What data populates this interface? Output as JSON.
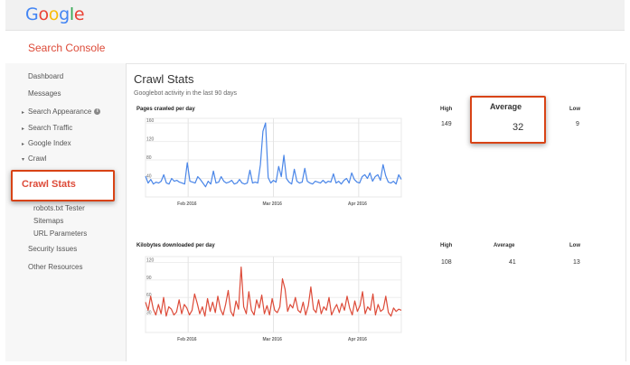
{
  "header": {
    "logo": [
      "G",
      "o",
      "o",
      "g",
      "l",
      "e"
    ],
    "logo_colors": [
      "#4285f4",
      "#ea4335",
      "#fbbc05",
      "#4285f4",
      "#34a853",
      "#ea4335"
    ],
    "product": "Search Console"
  },
  "sidebar": {
    "dashboard": "Dashboard",
    "messages": "Messages",
    "search_appearance": "Search Appearance",
    "search_traffic": "Search Traffic",
    "google_index": "Google Index",
    "crawl": "Crawl",
    "robots_tester": "robots.txt Tester",
    "sitemaps": "Sitemaps",
    "url_parameters": "URL Parameters",
    "security_issues": "Security Issues",
    "other_resources": "Other Resources",
    "info_glyph": "i",
    "caret_right": "▸",
    "caret_down": "▾"
  },
  "callouts": {
    "crawl_stats": "Crawl Stats",
    "average_label": "Average",
    "average_value": "32"
  },
  "main": {
    "title": "Crawl Stats",
    "subtitle": "Googlebot activity in the last 90 days"
  },
  "colors": {
    "accent": "#dd4b39",
    "highlight_border": "#d84315",
    "pages_line": "#4a86e8",
    "kb_line": "#dd4b39"
  },
  "stats": [
    {
      "high_label": "High",
      "high": "149",
      "avg_label": "Average",
      "avg": "32",
      "low_label": "Low",
      "low": "9"
    },
    {
      "high_label": "High",
      "high": "108",
      "avg_label": "Average",
      "avg": "41",
      "low_label": "Low",
      "low": "13"
    }
  ],
  "chart_data": [
    {
      "type": "line",
      "title": "Pages crawled per day",
      "x_ticks": [
        "Feb 2016",
        "Mar 2016",
        "Apr 2016"
      ],
      "y_ticks": [
        40,
        80,
        120,
        160
      ],
      "ylim": [
        0,
        170
      ],
      "grid": true,
      "series": [
        {
          "values": [
            45,
            30,
            38,
            28,
            32,
            30,
            34,
            48,
            30,
            28,
            40,
            34,
            36,
            32,
            30,
            28,
            74,
            34,
            32,
            30,
            44,
            38,
            30,
            22,
            34,
            28,
            56,
            30,
            32,
            44,
            34,
            30,
            32,
            36,
            28,
            30,
            38,
            30,
            28,
            30,
            58,
            30,
            32,
            30,
            70,
            142,
            160,
            42,
            30,
            36,
            32,
            66,
            44,
            90,
            40,
            32,
            28,
            60,
            34,
            30,
            32,
            62,
            34,
            30,
            28,
            34,
            32,
            30,
            36,
            30,
            34,
            32,
            50,
            30,
            34,
            28,
            36,
            40,
            30,
            52,
            38,
            32,
            30,
            44,
            48,
            40,
            52,
            34,
            44,
            48,
            36,
            70,
            46,
            32,
            30,
            34,
            28,
            48,
            38
          ]
        }
      ]
    },
    {
      "type": "line",
      "title": "Kilobytes downloaded per day",
      "x_ticks": [
        "Feb 2016",
        "Mar 2016",
        "Apr 2016"
      ],
      "y_ticks": [
        30,
        60,
        90,
        120
      ],
      "ylim": [
        0,
        130
      ],
      "grid": true,
      "series": [
        {
          "values": [
            52,
            38,
            62,
            40,
            30,
            48,
            32,
            60,
            28,
            44,
            40,
            30,
            35,
            56,
            32,
            48,
            42,
            30,
            38,
            66,
            50,
            32,
            44,
            28,
            58,
            36,
            52,
            34,
            62,
            40,
            30,
            48,
            72,
            36,
            28,
            54,
            40,
            112,
            44,
            32,
            70,
            38,
            30,
            56,
            42,
            64,
            32,
            46,
            30,
            58,
            38,
            34,
            44,
            92,
            74,
            36,
            48,
            42,
            60,
            38,
            34,
            52,
            30,
            46,
            78,
            40,
            34,
            56,
            32,
            44,
            38,
            60,
            30,
            40,
            48,
            34,
            50,
            38,
            62,
            42,
            30,
            54,
            36,
            46,
            70,
            32,
            44,
            38,
            66,
            30,
            48,
            36,
            40,
            62,
            34,
            28,
            42,
            36,
            40,
            38
          ]
        }
      ]
    }
  ]
}
